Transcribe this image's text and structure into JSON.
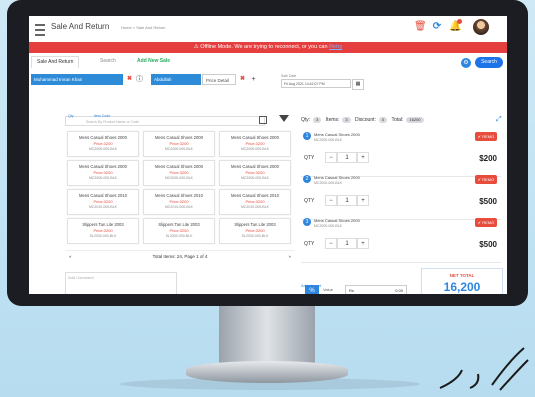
{
  "app": {
    "title": "Sale And Return",
    "breadcrumb": "Home > Sale And Return"
  },
  "alert": {
    "text": "⚠ Offline Mode. We are trying to reconnect, or you can",
    "link": "Retry"
  },
  "tabs": [
    "Sale And Return",
    "Search",
    "Add New Sale"
  ],
  "search_button": "Search",
  "customer": {
    "name": "Muhammad Imran Khan",
    "warehouse": "Abdullah",
    "price_list": "Price Detail"
  },
  "sale_date": {
    "label": "Sale Date",
    "value": "Fri Aug 2021 14:42:07 PM"
  },
  "filter": {
    "label_qty": "Qty",
    "label_item": "Item Code",
    "placeholder": "Search By Product Name or Code"
  },
  "products": [
    {
      "name": "Mens Casual Shoes 2000",
      "price": "Price:3200",
      "code": "MC2000-000-BLK"
    },
    {
      "name": "Mens Casual Shoes 2000",
      "price": "Price:3200",
      "code": "MC2000-000-BLK"
    },
    {
      "name": "Mens Casual Shoes 2000",
      "price": "Price:3200",
      "code": "MC2000-000-BLK"
    },
    {
      "name": "Mens Casual Shoes 2000",
      "price": "Price:3200",
      "code": "MC2000-000-BLK"
    },
    {
      "name": "Mens Casual Shoes 2000",
      "price": "Price:3200",
      "code": "MC2000-000-BLK"
    },
    {
      "name": "Mens Casual Shoes 2000",
      "price": "Price:3200",
      "code": "MC2000-000-BLK"
    },
    {
      "name": "Mens Casual Shoes 2010",
      "price": "Price:3200",
      "code": "MC2010-000-BLK"
    },
    {
      "name": "Mens Casual Shoes 2010",
      "price": "Price:3200",
      "code": "MC2010-000-BLK"
    },
    {
      "name": "Mens Casual Shoes 2010",
      "price": "Price:3200",
      "code": "MC2010-000-BLK"
    },
    {
      "name": "Slippers Tan Lite 2003",
      "price": "Price:3200",
      "code": "SL2003-000-BLK"
    },
    {
      "name": "Slippers Tan Lite 2003",
      "price": "Price:3200",
      "code": "SL2003-000-BLK"
    },
    {
      "name": "Slippers Tan Lite 2003",
      "price": "Price:3200",
      "code": "SL2003-000-BLK"
    }
  ],
  "pager": {
    "prev": "«",
    "text": "Total Items: 24, Page 1 of 4",
    "next": "»"
  },
  "comment_placeholder": "Add Comment",
  "summary": {
    "qty_label": "Qty:",
    "qty": "3",
    "items_label": "Items:",
    "items": "3",
    "discount_label": "Discount:",
    "discount": "0",
    "total_label": "Total:",
    "total": "16200"
  },
  "cart": [
    {
      "num": "1",
      "name": "Mens Casual Shoes 2000",
      "code": "MC2000-000-BLK",
      "remove": "✔ REMO",
      "qty_label": "QTY",
      "qty": "1",
      "total": "$200"
    },
    {
      "num": "2",
      "name": "Mens Casual Shoes 2000",
      "code": "MC2000-000-BLK",
      "remove": "✔ REMO",
      "qty_label": "QTY",
      "qty": "1",
      "total": "$500"
    },
    {
      "num": "3",
      "name": "Mens Casual Shoes 2000",
      "code": "MC2000-000-BLK",
      "remove": "✔ REMO",
      "qty_label": "QTY",
      "qty": "1",
      "total": "$500"
    }
  ],
  "adjustment": {
    "label": "Adjustment",
    "pct": "%",
    "value_label": "Value",
    "rs": "Rs",
    "amount": "0.00"
  },
  "net_total": {
    "label": "NET TOTAL",
    "amount": "16,200"
  },
  "icons": [
    "menu-icon",
    "trash-icon",
    "sync-icon",
    "bell-icon",
    "gear-icon",
    "calendar-icon",
    "grid-icon",
    "filter-icon",
    "expand-icon"
  ]
}
